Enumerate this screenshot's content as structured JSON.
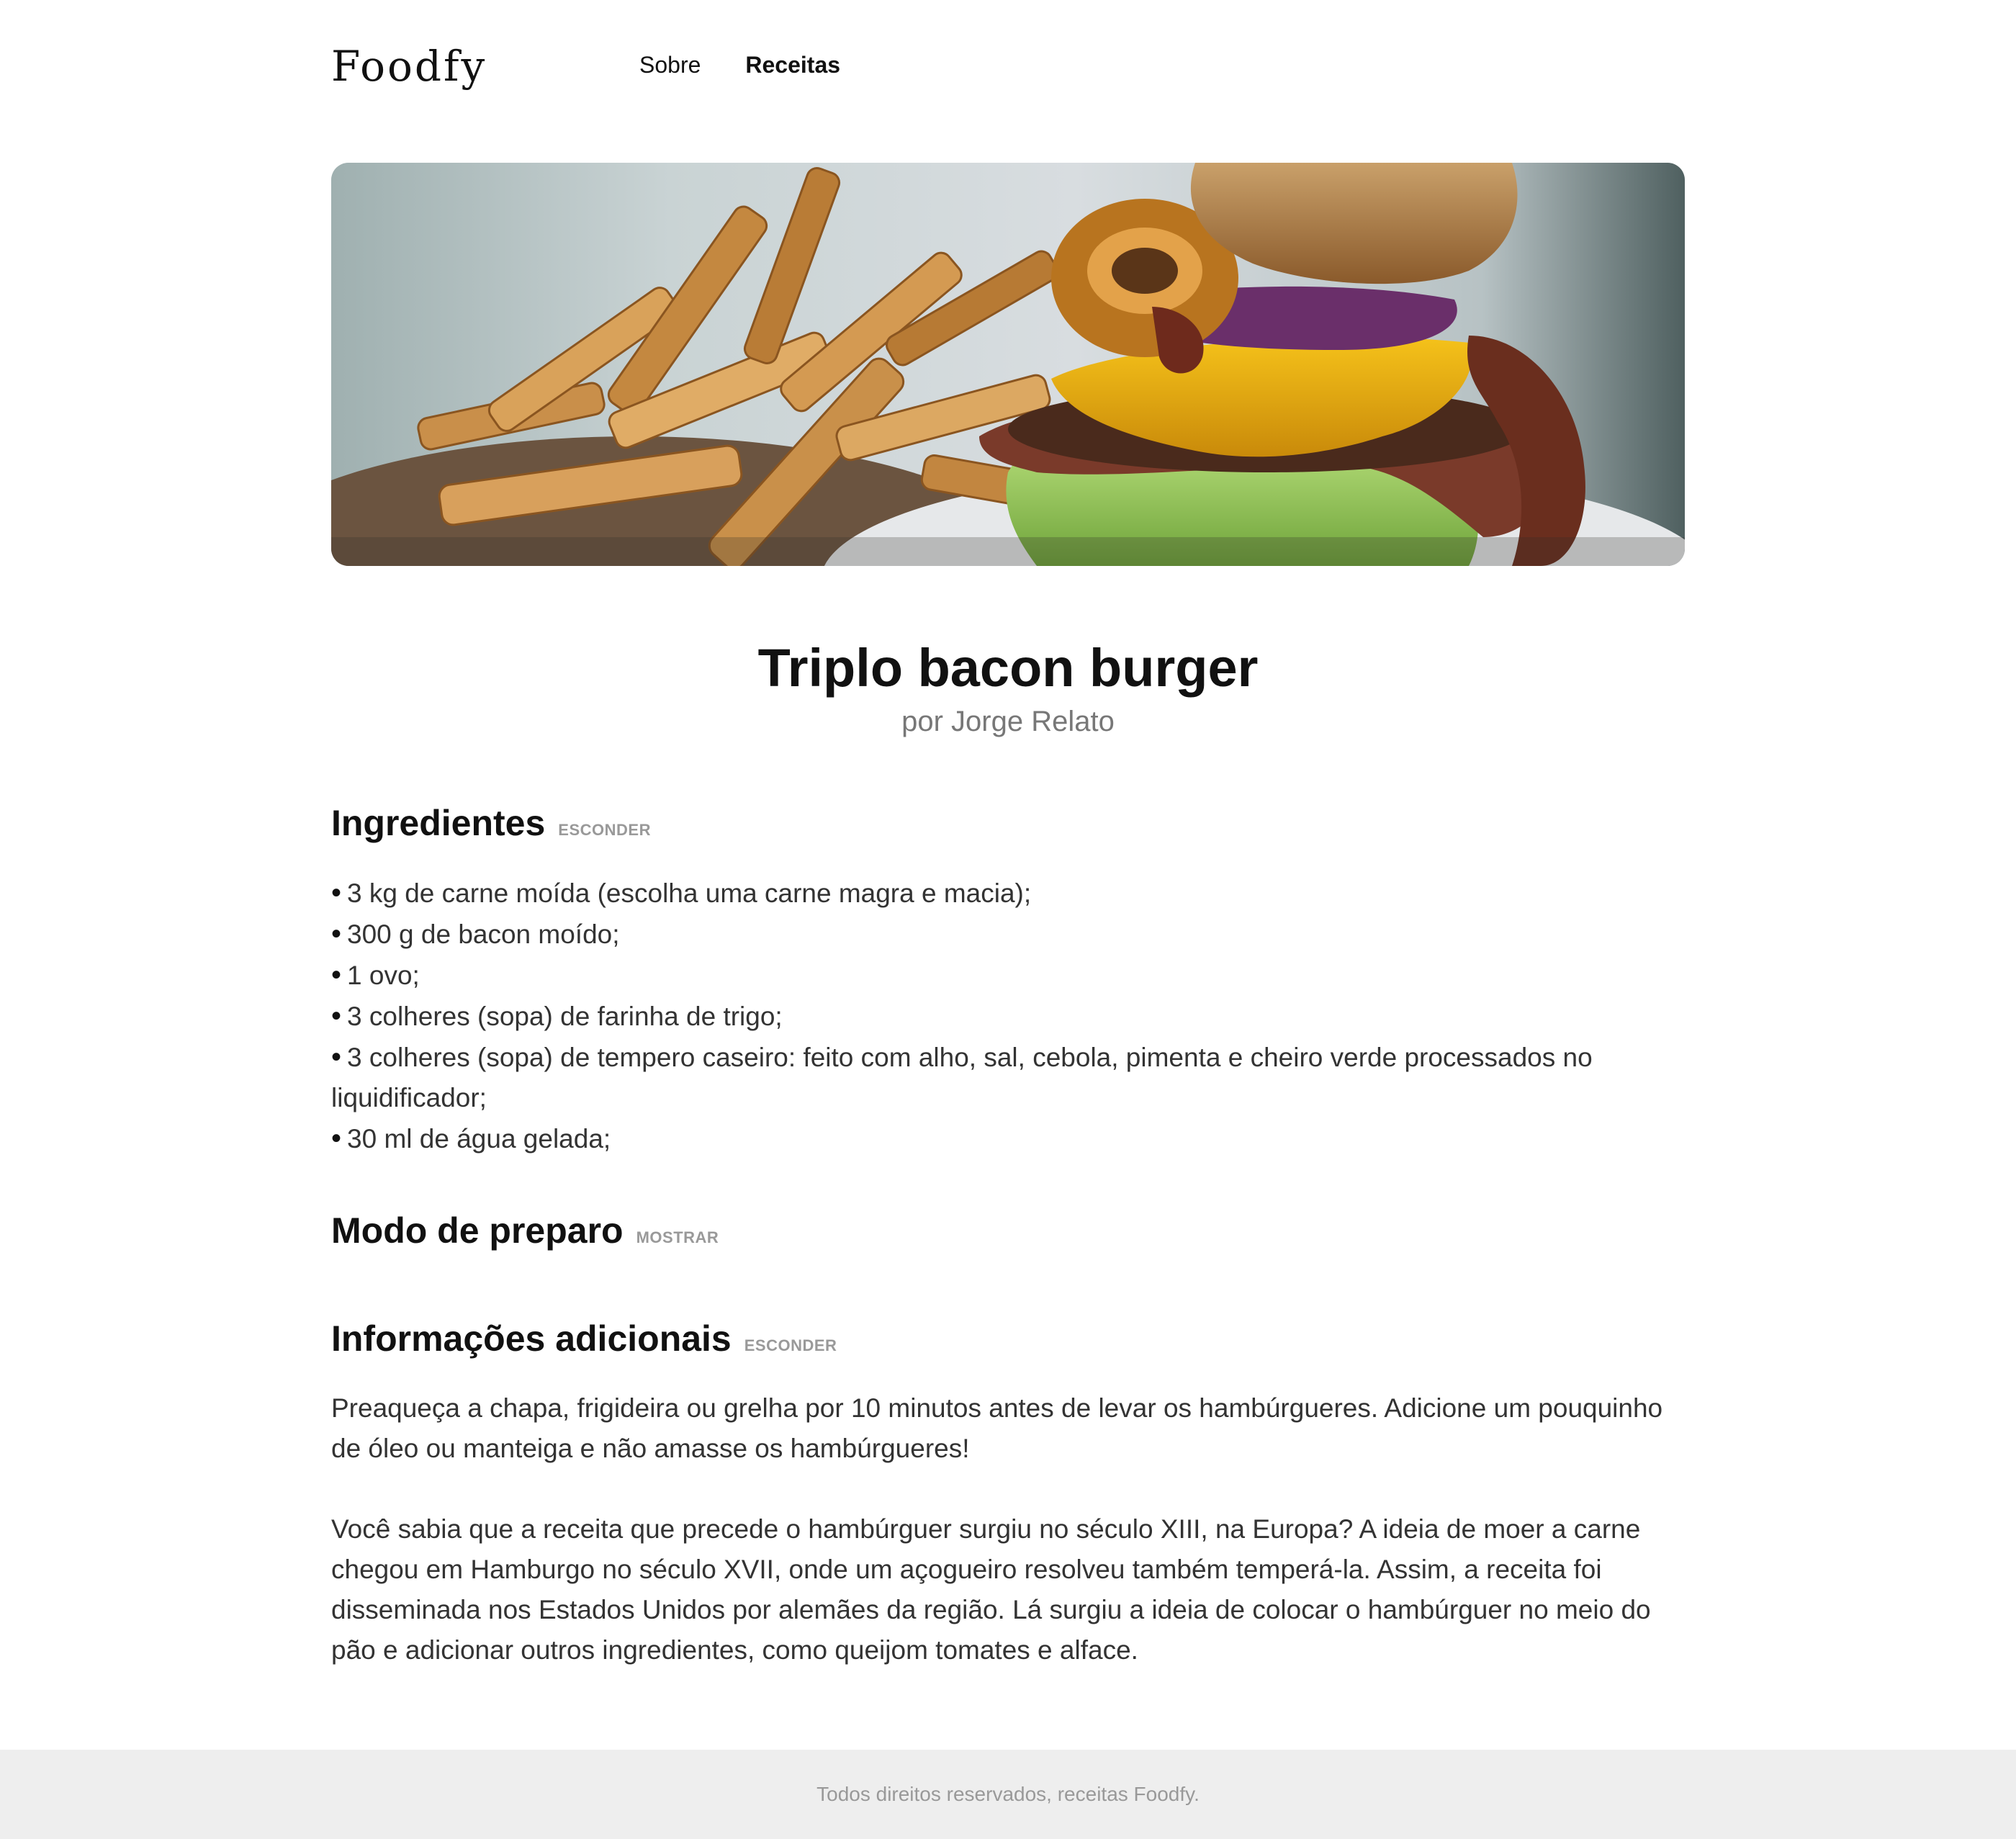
{
  "header": {
    "logo": "Foodfy",
    "nav": {
      "sobre": "Sobre",
      "receitas": "Receitas"
    }
  },
  "recipe": {
    "image_alt": "Triplo bacon burger",
    "title": "Triplo bacon burger",
    "author": "por Jorge Relato"
  },
  "ingredients": {
    "title": "Ingredientes",
    "toggle": "ESCONDER",
    "items": [
      "3 kg de carne moída (escolha uma carne magra e macia);",
      "300 g de bacon moído;",
      "1 ovo;",
      "3 colheres (sopa) de farinha de trigo;",
      "3 colheres (sopa) de tempero caseiro: feito com alho, sal, cebola, pimenta e cheiro verde processados no liquidificador;",
      "30 ml de água gelada;"
    ]
  },
  "preparation": {
    "title": "Modo de preparo",
    "toggle": "MOSTRAR"
  },
  "information": {
    "title": "Informações adicionais",
    "toggle": "ESCONDER",
    "paragraphs": [
      "Preaqueça a chapa, frigideira ou grelha por 10 minutos antes de levar os hambúrgueres. Adicione um pouquinho de óleo ou manteiga e não amasse os hambúrgueres!",
      "Você sabia que a receita que precede o hambúrguer surgiu no século XIII, na Europa? A ideia de moer a carne chegou em Hamburgo no século XVII, onde um açogueiro resolveu também temperá-la. Assim, a receita foi disseminada nos Estados Unidos por alemães da região. Lá surgiu a ideia de colocar o hambúrguer no meio do pão e adicionar outros ingredientes, como queijom tomates e alface."
    ]
  },
  "footer": {
    "text": "Todos direitos reservados, receitas Foodfy."
  }
}
